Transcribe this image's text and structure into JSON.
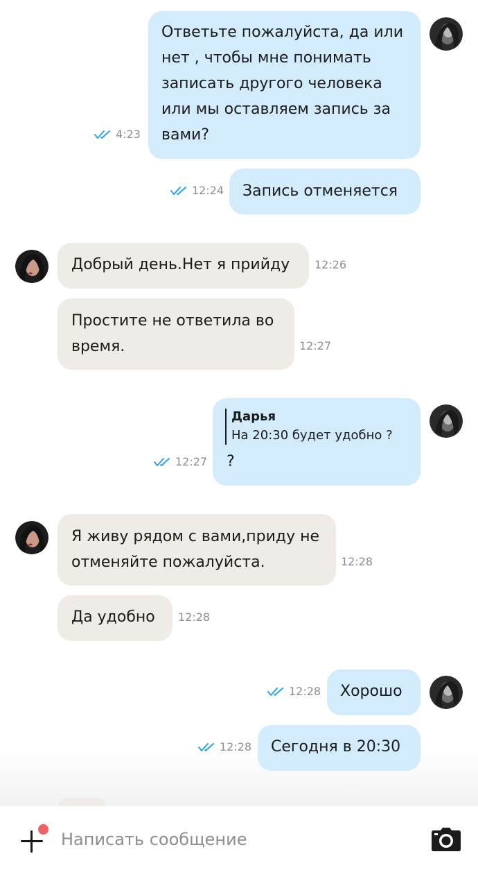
{
  "messages": [
    {
      "dir": "out",
      "text_lines": [
        "Ответьте пожалуйста, да или",
        "нет , чтобы мне понимать",
        "записать другого человека",
        "или мы оставляем запись за",
        "вами?"
      ],
      "time": "4:23",
      "read": true
    },
    {
      "dir": "out",
      "text": "Запись отменяется",
      "time": "12:24",
      "read": true
    },
    {
      "dir": "in",
      "text": "Добрый день.Нет я прийду",
      "time": "12:26"
    },
    {
      "dir": "in",
      "text_lines": [
        "Простите не ответила во",
        "время."
      ],
      "time": "12:27"
    },
    {
      "dir": "out",
      "reply": {
        "author": "Дарья",
        "text": "На 20:30 будет удобно ?"
      },
      "text": "?",
      "time": "12:27",
      "read": true
    },
    {
      "dir": "in",
      "text_lines": [
        "Я живу рядом с вами,приду не",
        "отменяйте пожалуйста."
      ],
      "time": "12:28"
    },
    {
      "dir": "in",
      "text": "Да удобно",
      "time": "12:28"
    },
    {
      "dir": "out",
      "text": "Хорошо",
      "time": "12:28",
      "read": true
    },
    {
      "dir": "out",
      "text": "Сегодня в 20:30",
      "time": "12:28",
      "read": true
    }
  ],
  "composer": {
    "placeholder": "Написать сообщение",
    "has_attachment_badge": true
  },
  "icons": {
    "attach": "plus-icon",
    "camera": "camera-icon",
    "read": "double-check-icon"
  },
  "colors": {
    "outgoing_bubble": "#d2ecfd",
    "incoming_bubble": "#efebe6",
    "read_check": "#2aa3ef",
    "badge": "#f25f64"
  }
}
